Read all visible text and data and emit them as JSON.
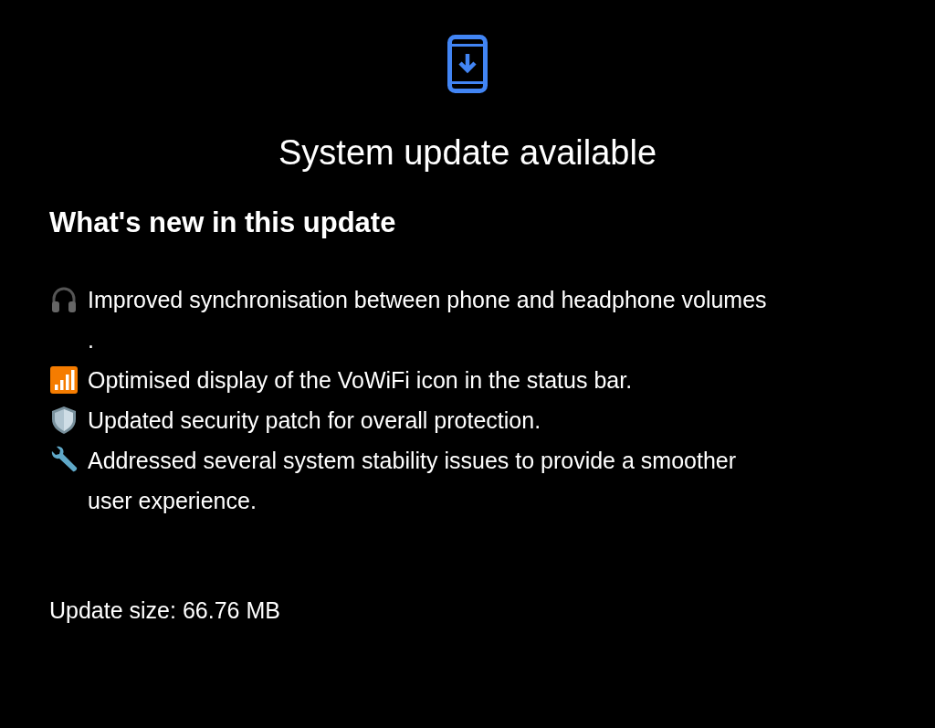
{
  "title": "System update available",
  "heading": "What's new in this update",
  "items": [
    {
      "kind": "headphones",
      "text": "Improved synchronisation between phone and headphone volumes ."
    },
    {
      "kind": "signal",
      "text": "Optimised display of the VoWiFi icon in the status bar."
    },
    {
      "kind": "shield",
      "text": "Updated security patch for overall protection."
    },
    {
      "kind": "wrench",
      "text": "Addressed several system stability issues to provide a smoother user experience."
    }
  ],
  "update_size": "Update size: 66.76 MB"
}
